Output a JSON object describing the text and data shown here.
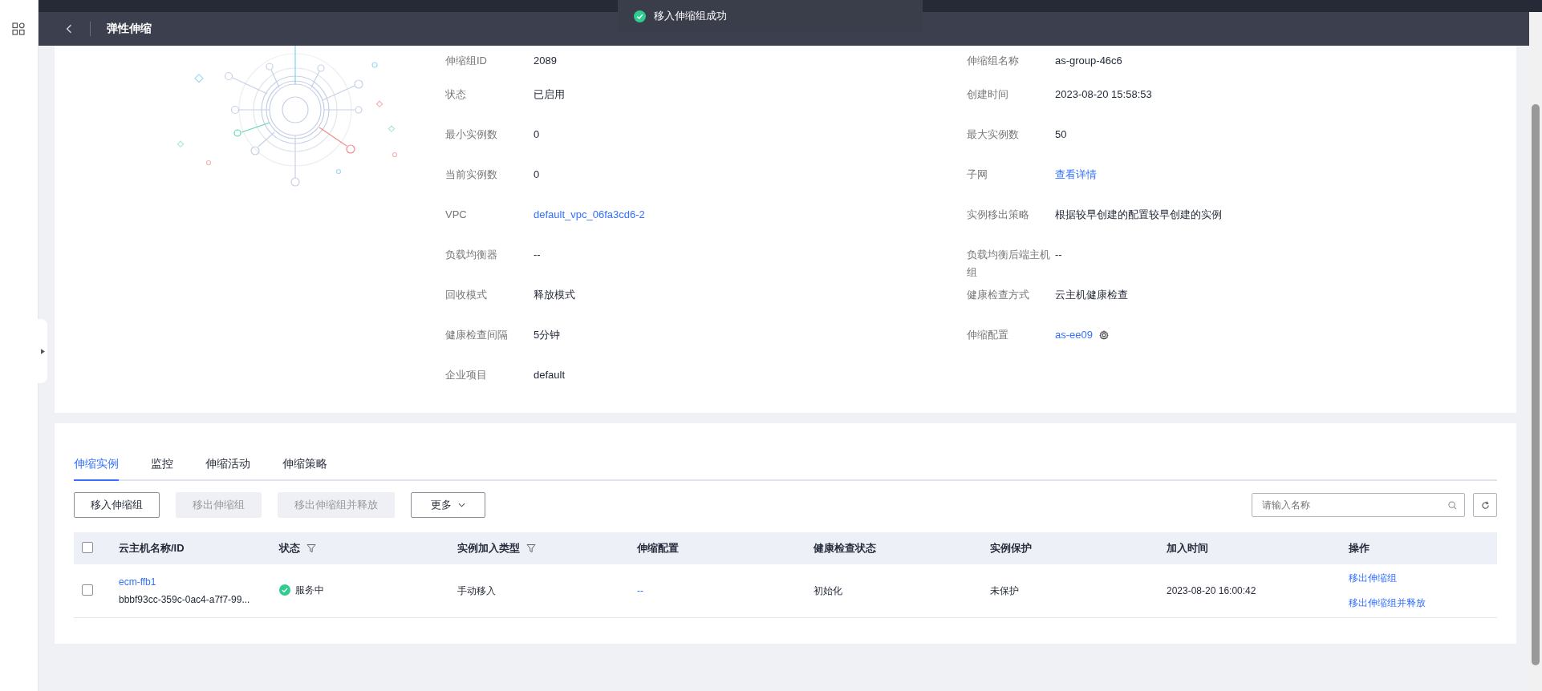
{
  "header": {
    "title": "弹性伸缩"
  },
  "toast": {
    "text": "移入伸缩组成功"
  },
  "details": {
    "left": [
      {
        "label": "伸缩组ID",
        "value": "2089",
        "kind": "text"
      },
      {
        "label": "状态",
        "value": "已启用",
        "kind": "text"
      },
      {
        "label": "最小实例数",
        "value": "0",
        "kind": "text"
      },
      {
        "label": "当前实例数",
        "value": "0",
        "kind": "text"
      },
      {
        "label": "VPC",
        "value": "default_vpc_06fa3cd6-2",
        "kind": "link"
      },
      {
        "label": "负载均衡器",
        "value": "--",
        "kind": "text"
      },
      {
        "label": "回收模式",
        "value": "释放模式",
        "kind": "text"
      },
      {
        "label": "健康检查间隔",
        "value": "5分钟",
        "kind": "text"
      },
      {
        "label": "企业项目",
        "value": "default",
        "kind": "text"
      }
    ],
    "right": [
      {
        "label": "伸缩组名称",
        "value": "as-group-46c6",
        "kind": "text"
      },
      {
        "label": "创建时间",
        "value": "2023-08-20 15:58:53",
        "kind": "text"
      },
      {
        "label": "最大实例数",
        "value": "50",
        "kind": "text"
      },
      {
        "label": "子网",
        "value": "查看详情",
        "kind": "link"
      },
      {
        "label": "实例移出策略",
        "value": "根据较早创建的配置较早创建的实例",
        "kind": "text"
      },
      {
        "label": "负载均衡后端主机组",
        "value": "--",
        "kind": "text"
      },
      {
        "label": "健康检查方式",
        "value": "云主机健康检查",
        "kind": "text"
      },
      {
        "label": "伸缩配置",
        "value": "as-ee09",
        "kind": "link_gear"
      }
    ]
  },
  "tabs": [
    {
      "label": "伸缩实例",
      "selected": true
    },
    {
      "label": "监控",
      "selected": false
    },
    {
      "label": "伸缩活动",
      "selected": false
    },
    {
      "label": "伸缩策略",
      "selected": false
    }
  ],
  "toolbar": {
    "buttons": [
      {
        "label": "移入伸缩组",
        "disabled": false
      },
      {
        "label": "移出伸缩组",
        "disabled": true
      },
      {
        "label": "移出伸缩组并释放",
        "disabled": true
      }
    ],
    "more": "更多",
    "search": {
      "placeholder": "请输入名称"
    }
  },
  "table": {
    "select_all": {
      "checked": false
    },
    "columns": [
      {
        "label": "云主机名称/ID",
        "filter": false
      },
      {
        "label": "状态",
        "filter": true
      },
      {
        "label": "实例加入类型",
        "filter": true
      },
      {
        "label": "伸缩配置",
        "filter": false
      },
      {
        "label": "健康检查状态",
        "filter": false
      },
      {
        "label": "实例保护",
        "filter": false
      },
      {
        "label": "加入时间",
        "filter": false
      },
      {
        "label": "操作",
        "filter": false
      }
    ],
    "rows": [
      {
        "checked": false,
        "name": "ecm-ffb1",
        "id": "bbbf93cc-359c-0ac4-a7f7-99...",
        "status": "服务中",
        "join_type": "手动移入",
        "config": "--",
        "health": "初始化",
        "protection": "未保护",
        "joined": "2023-08-20 16:00:42",
        "actions": [
          "移出伸缩组",
          "移出伸缩组并释放"
        ]
      }
    ]
  }
}
